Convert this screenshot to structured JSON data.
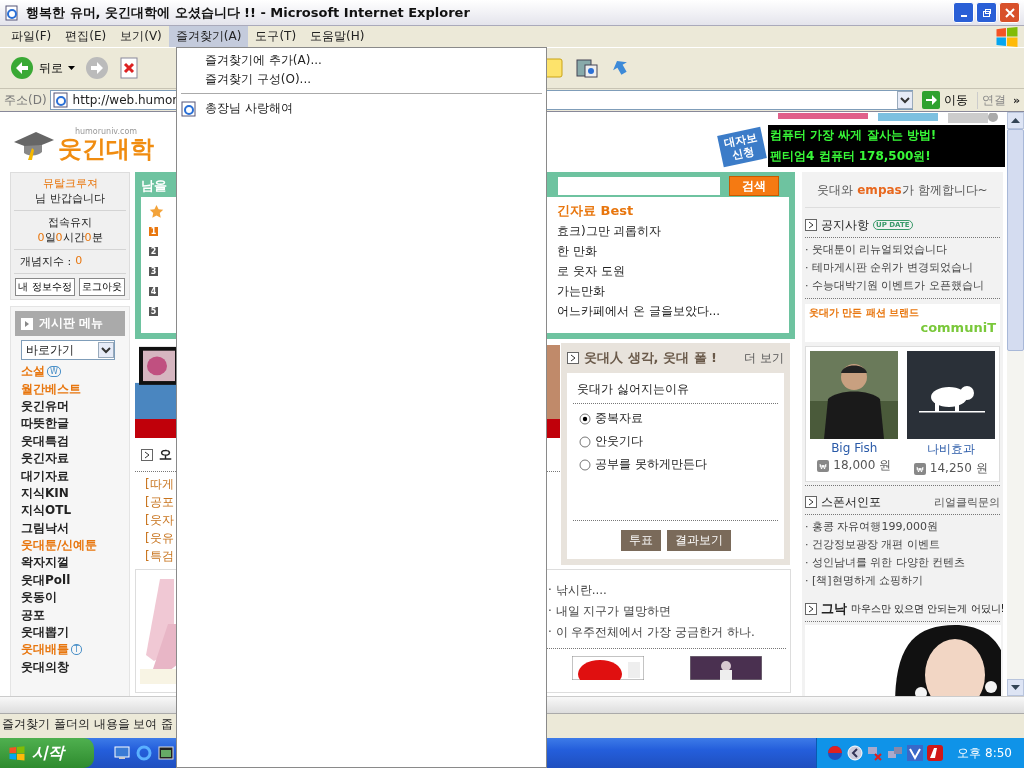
{
  "window": {
    "title": "행복한 유머, 웃긴대학에 오셨습니다 !! - Microsoft Internet Explorer"
  },
  "menubar": [
    {
      "label": "파일(F)",
      "selected": false
    },
    {
      "label": "편집(E)",
      "selected": false
    },
    {
      "label": "보기(V)",
      "selected": false
    },
    {
      "label": "즐겨찾기(A)",
      "selected": true
    },
    {
      "label": "도구(T)",
      "selected": false
    },
    {
      "label": "도움말(H)",
      "selected": false
    }
  ],
  "toolbar": {
    "back": "뒤로"
  },
  "address": {
    "label": "주소(D)",
    "value": "http://web.humor",
    "go": "이동",
    "links": "연결",
    "more": "»"
  },
  "favorites_menu": [
    {
      "kind": "command",
      "label": "즐겨찾기에 추가(A)..."
    },
    {
      "kind": "command",
      "label": "즐겨찾기 구성(O)..."
    },
    {
      "kind": "separator"
    },
    {
      "kind": "link",
      "label": "총장님 사랑해여"
    }
  ],
  "site": {
    "logo": {
      "name": "웃긴대학",
      "domain": "humoruniv.com"
    },
    "banner": {
      "tag": "대자보 신청",
      "lines": [
        "컴퓨터 가장 싸게 잘사는 방법!",
        "펜티엄4 컴퓨터 178,500원!"
      ]
    },
    "login": {
      "user": "뮤탈크루져",
      "greeting": "님 반갑습니다",
      "session_label": "접속유지",
      "session": [
        {
          "value": "0",
          "unit": "일"
        },
        {
          "value": "0",
          "unit": "시간"
        },
        {
          "value": "0",
          "unit": "분"
        }
      ],
      "score_label": "개념지수 :",
      "score": "0",
      "buttons": [
        "내 정보수정",
        "로그아웃"
      ]
    },
    "board_menu": {
      "title": "게시판 메뉴",
      "jump": "바로가기",
      "items": [
        {
          "label": "소설",
          "highlighted": true,
          "badge": "W"
        },
        {
          "label": "월간베스트",
          "highlighted": true
        },
        {
          "label": "웃긴유머",
          "highlighted": false
        },
        {
          "label": "따뜻한글",
          "highlighted": false
        },
        {
          "label": "웃대특검",
          "highlighted": false
        },
        {
          "label": "웃긴자료",
          "highlighted": false
        },
        {
          "label": "대기자료",
          "highlighted": false
        },
        {
          "label": "지식KIN",
          "highlighted": false
        },
        {
          "label": "지식OTL",
          "highlighted": false
        },
        {
          "label": "그림낙서",
          "highlighted": false
        },
        {
          "label": "웃대툰/신예툰",
          "highlighted": true
        },
        {
          "label": "왁자지껄",
          "highlighted": false
        },
        {
          "label": "웃대Poll",
          "highlighted": false
        },
        {
          "label": "웃동이",
          "highlighted": false
        },
        {
          "label": "공포",
          "highlighted": false
        },
        {
          "label": "웃대뽑기",
          "highlighted": false
        },
        {
          "label": "웃대배틀",
          "highlighted": true,
          "badge": "T"
        },
        {
          "label": "웃대의창",
          "highlighted": false
        }
      ]
    },
    "search": {
      "title": "남을",
      "button": "검색"
    },
    "best": {
      "title_right": "긴자료 Best",
      "rows": [
        {
          "rank": "1",
          "color": "#e8760e",
          "right": "효크)그만 괴롭히자"
        },
        {
          "rank": "2",
          "color": "#555555",
          "right": "한 만화"
        },
        {
          "rank": "3",
          "color": "#555555",
          "right": "로 웃자 도원"
        },
        {
          "rank": "4",
          "color": "#555555",
          "right": "가는만화"
        },
        {
          "rank": "5",
          "color": "#555555",
          "right": "어느카페에서 온 글을보았다..."
        }
      ]
    },
    "today": {
      "title": "오",
      "links": [
        "[따게",
        "[공포",
        "[웃자",
        "[웃유",
        "[특검"
      ]
    },
    "poll": {
      "title": "웃대人 생각, 웃대 폴 !",
      "more": "더 보기",
      "question": "웃대가 싫어지는이유",
      "options": [
        {
          "label": "중복자료",
          "selected": true
        },
        {
          "label": "안웃기다",
          "selected": false
        },
        {
          "label": "공부를 못하게만든다",
          "selected": false
        }
      ],
      "buttons": [
        "투표",
        "결과보기"
      ]
    },
    "posts": [
      "· 낚시란....",
      "· 내일 지구가 멸망하면",
      "· 이 우주전체에서 가장 궁금한거 하나."
    ],
    "partner": {
      "prefix": "웃대와",
      "brand": "empas",
      "suffix": "가 함께합니다~"
    },
    "notice": {
      "title": "공지사항",
      "badge": "UP DATE",
      "items": [
        "· 웃대툰이 리뉴얼되었습니다",
        "· 테마게시판 순위가 변경되었습니",
        "· 수능대박기원 이벤트가 오픈했습니"
      ]
    },
    "fashion": {
      "slogan": "웃대가 만든 패션 브랜드",
      "brand": "communiT",
      "products": [
        {
          "name": "Big Fish",
          "price": "18,000 원"
        },
        {
          "name": "나비효과",
          "price": "14,250 원"
        }
      ]
    },
    "sponsor": {
      "title": "스폰서인포",
      "link": "리얼클릭문의",
      "items": [
        "· 홍콩 자유여행199,000원",
        "· 건강정보광장 개편 이벤트",
        "· 성인남녀를 위한 다양한 컨텐츠",
        "· [책]현명하게 쇼핑하기"
      ]
    },
    "gnak": {
      "title": "그낙",
      "text": "마우스만 있으면 안되는게 어딨니!"
    }
  },
  "status_bar": {
    "text": "즐겨찾기 폴더의 내용을 보여 줍"
  },
  "taskbar": {
    "start": "시작",
    "clock": "오후 8:50"
  }
}
